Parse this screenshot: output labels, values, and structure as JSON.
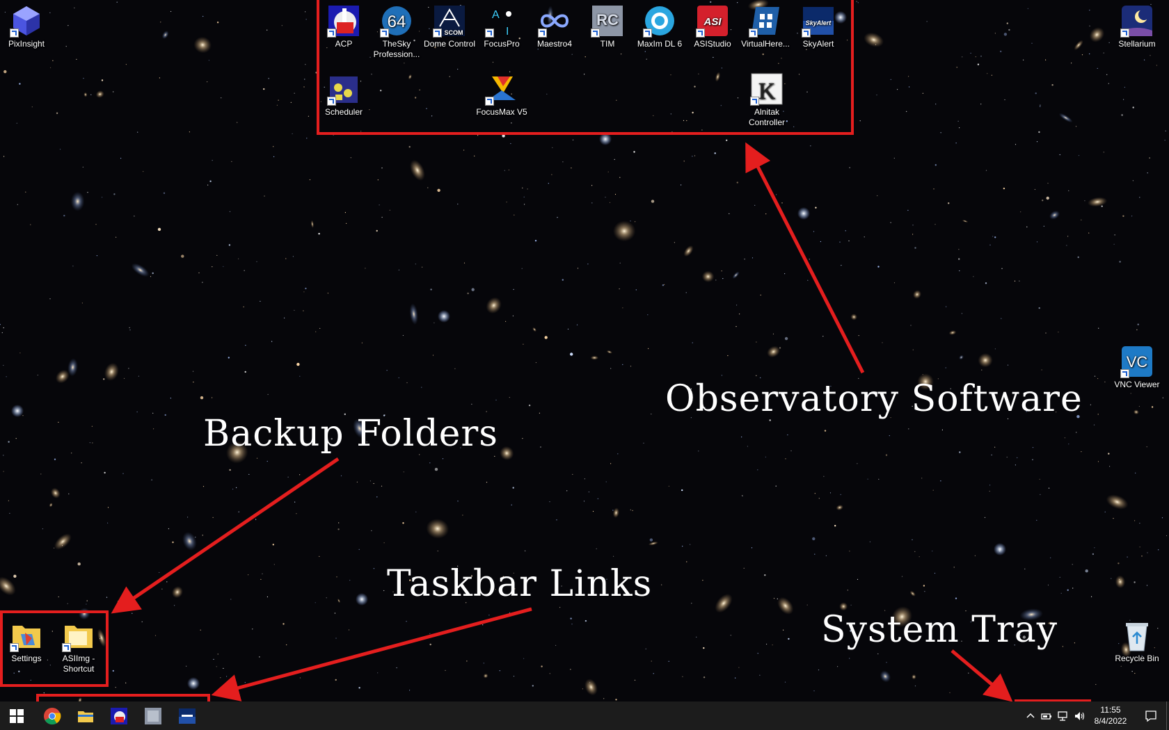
{
  "desktop": {
    "left_icons": [
      {
        "label": "PixInsight",
        "icon": "pixinsight-icon"
      }
    ],
    "observatory_icons_row1": [
      {
        "label": "ACP",
        "icon": "acp-icon"
      },
      {
        "label": "TheSky Profession...",
        "icon": "thesky-64-icon",
        "badge": "64"
      },
      {
        "label": "Dome Control",
        "icon": "ascom-dome-icon",
        "badge": "SCOM"
      },
      {
        "label": "FocusPro",
        "icon": "focuspro-icon"
      },
      {
        "label": "Maestro4",
        "icon": "maestro-infinity-icon"
      },
      {
        "label": "TIM",
        "icon": "tim-icon",
        "badge": "RC"
      },
      {
        "label": "MaxIm DL 6",
        "icon": "maxim-dl-icon"
      },
      {
        "label": "ASIStudio",
        "icon": "asistudio-icon",
        "badge": "ASI"
      },
      {
        "label": "VirtualHere...",
        "icon": "virtualhere-icon"
      },
      {
        "label": "SkyAlert",
        "icon": "skyalert-icon",
        "badge": "SkyAlert"
      }
    ],
    "observatory_icons_row2": [
      {
        "label": "Scheduler",
        "icon": "scheduler-icon"
      },
      {
        "label": "FocusMax V5",
        "icon": "focusmax-icon"
      },
      {
        "label": "Alnitak Controller",
        "icon": "alnitak-controller-icon",
        "badge": "K"
      }
    ],
    "right_icons": [
      {
        "label": "Stellarium",
        "icon": "stellarium-icon"
      },
      {
        "label": "VNC Viewer",
        "icon": "vnc-viewer-icon",
        "badge": "VC"
      },
      {
        "label": "Recycle Bin",
        "icon": "recycle-bin-icon"
      }
    ],
    "backup_icons": [
      {
        "label": "Settings",
        "icon": "settings-folder-icon"
      },
      {
        "label": "ASIImg - Shortcut",
        "icon": "asiimg-folder-icon"
      }
    ]
  },
  "annotations": {
    "observatory": "Observatory Software",
    "backup": "Backup Folders",
    "taskbar": "Taskbar Links",
    "tray": "System Tray"
  },
  "taskbar": {
    "pinned": [
      {
        "name": "chrome",
        "icon": "chrome-icon"
      },
      {
        "name": "file-explorer",
        "icon": "folder-icon"
      },
      {
        "name": "acp",
        "icon": "acp-icon"
      },
      {
        "name": "tim",
        "icon": "tim-icon"
      },
      {
        "name": "skyalert",
        "icon": "skyalert-icon"
      }
    ],
    "time": "11:55",
    "date": "8/4/2022"
  },
  "colors": {
    "annotation_red": "#e41e1e",
    "taskbar_bg": "#1c1c1c"
  }
}
